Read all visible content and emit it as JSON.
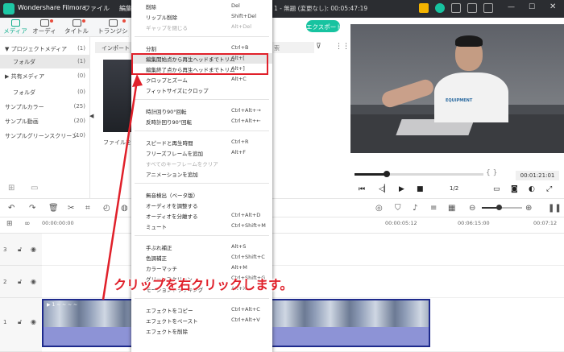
{
  "app": {
    "name": "Wondershare Filmora",
    "menu": [
      "ファイル",
      "編集",
      "ツ"
    ],
    "project_info": "1 - 無題 (変更なし): 00:05:47:19",
    "export_label": "エクスポート"
  },
  "tabs": [
    {
      "label": "メディア",
      "active": true,
      "dot": false
    },
    {
      "label": "オーディオ",
      "active": false,
      "dot": true
    },
    {
      "label": "タイトル",
      "active": false,
      "dot": true
    },
    {
      "label": "トランジション",
      "active": false,
      "dot": true
    }
  ],
  "left_panel": {
    "items": [
      {
        "label": "プロジェクトメディア",
        "count": "(1)",
        "prefix": "▼ "
      },
      {
        "label": "フォルダ",
        "count": "(1)",
        "prefix": ""
      },
      {
        "label": "共有メディア",
        "count": "(0)",
        "prefix": "▶ "
      },
      {
        "label": "フォルダ",
        "count": "(0)",
        "prefix": ""
      },
      {
        "label": "サンプルカラー",
        "count": "(25)",
        "prefix": ""
      },
      {
        "label": "サンプル動画",
        "count": "(20)",
        "prefix": ""
      },
      {
        "label": "サンプルグリーンスクリーン",
        "count": "(10)",
        "prefix": ""
      }
    ]
  },
  "media": {
    "import_label": "インポート",
    "thumb_caption": "ファイルをイ",
    "search_placeholder": "索"
  },
  "preview": {
    "shirt_text": "EQUIPMENT",
    "timecode": "00:01:21:01",
    "ratio": "1/2",
    "brackets": "{   }"
  },
  "ruler": {
    "ticks": [
      "00:00:00:00",
      "00:00:05:12",
      "00:06:15:00",
      "00:07:12"
    ]
  },
  "tracks": [
    {
      "num": "3"
    },
    {
      "num": "2"
    },
    {
      "num": "1"
    }
  ],
  "clip": {
    "label": "▶ 1 ~ ~ ~ ~"
  },
  "context_menu": {
    "items": [
      {
        "label": "削除",
        "shortcut": "Del",
        "disabled": false
      },
      {
        "label": "リップル削除",
        "shortcut": "Shift+Del",
        "disabled": false
      },
      {
        "label": "ギャップを閉じる",
        "shortcut": "Alt+Del",
        "disabled": true
      },
      {
        "label": "分割",
        "shortcut": "Ctrl+B",
        "disabled": false
      },
      {
        "label": "編集開始点から再生ヘッドまでトリム",
        "shortcut": "Alt+[",
        "disabled": false,
        "hover": true
      },
      {
        "label": "編集終了点から再生ヘッドまでトリム",
        "shortcut": "Alt+]",
        "disabled": false
      },
      {
        "label": "クロップとズーム",
        "shortcut": "Alt+C",
        "disabled": false
      },
      {
        "label": "フィットサイズにクロップ",
        "shortcut": "",
        "disabled": false
      },
      {
        "label": "時計回り90°回転",
        "shortcut": "Ctrl+Alt+→",
        "disabled": false
      },
      {
        "label": "反時計回り90°回転",
        "shortcut": "Ctrl+Alt+←",
        "disabled": false
      },
      {
        "label": "スピードと再生時間",
        "shortcut": "Ctrl+R",
        "disabled": false
      },
      {
        "label": "フリーズフレームを追加",
        "shortcut": "Alt+F",
        "disabled": false
      },
      {
        "label": "すべてのキーフレームをクリア",
        "shortcut": "",
        "disabled": true
      },
      {
        "label": "アニメーションを追加",
        "shortcut": "",
        "disabled": false
      },
      {
        "label": "無音検出（ベータ版）",
        "shortcut": "",
        "disabled": false
      },
      {
        "label": "オーディオを調整する",
        "shortcut": "",
        "disabled": false
      },
      {
        "label": "オーディオを分離する",
        "shortcut": "Ctrl+Alt+D",
        "disabled": false
      },
      {
        "label": "ミュート",
        "shortcut": "Ctrl+Shift+M",
        "disabled": false
      },
      {
        "label": "手ぶれ補正",
        "shortcut": "Alt+S",
        "disabled": false
      },
      {
        "label": "色調補正",
        "shortcut": "Ctrl+Shift+C",
        "disabled": false
      },
      {
        "label": "カラーマッチ",
        "shortcut": "Alt+M",
        "disabled": false
      },
      {
        "label": "グリーンスクリーン",
        "shortcut": "Ctrl+Shift+G",
        "disabled": false
      },
      {
        "label": "モーショントラッキング",
        "shortcut": "Alt+X",
        "disabled": false
      },
      {
        "label": "エフェクトをコピー",
        "shortcut": "Ctrl+Alt+C",
        "disabled": false
      },
      {
        "label": "エフェクトをペースト",
        "shortcut": "Ctrl+Alt+V",
        "disabled": false
      },
      {
        "label": "エフェクトを削除",
        "shortcut": "",
        "disabled": false
      }
    ]
  },
  "annotation": {
    "text": "クリップを右クリックします。",
    "color": "#e0202a"
  },
  "colors": {
    "accent": "#17c3a0",
    "highlight": "#e0202a",
    "clip_border": "#1e2a8c"
  }
}
